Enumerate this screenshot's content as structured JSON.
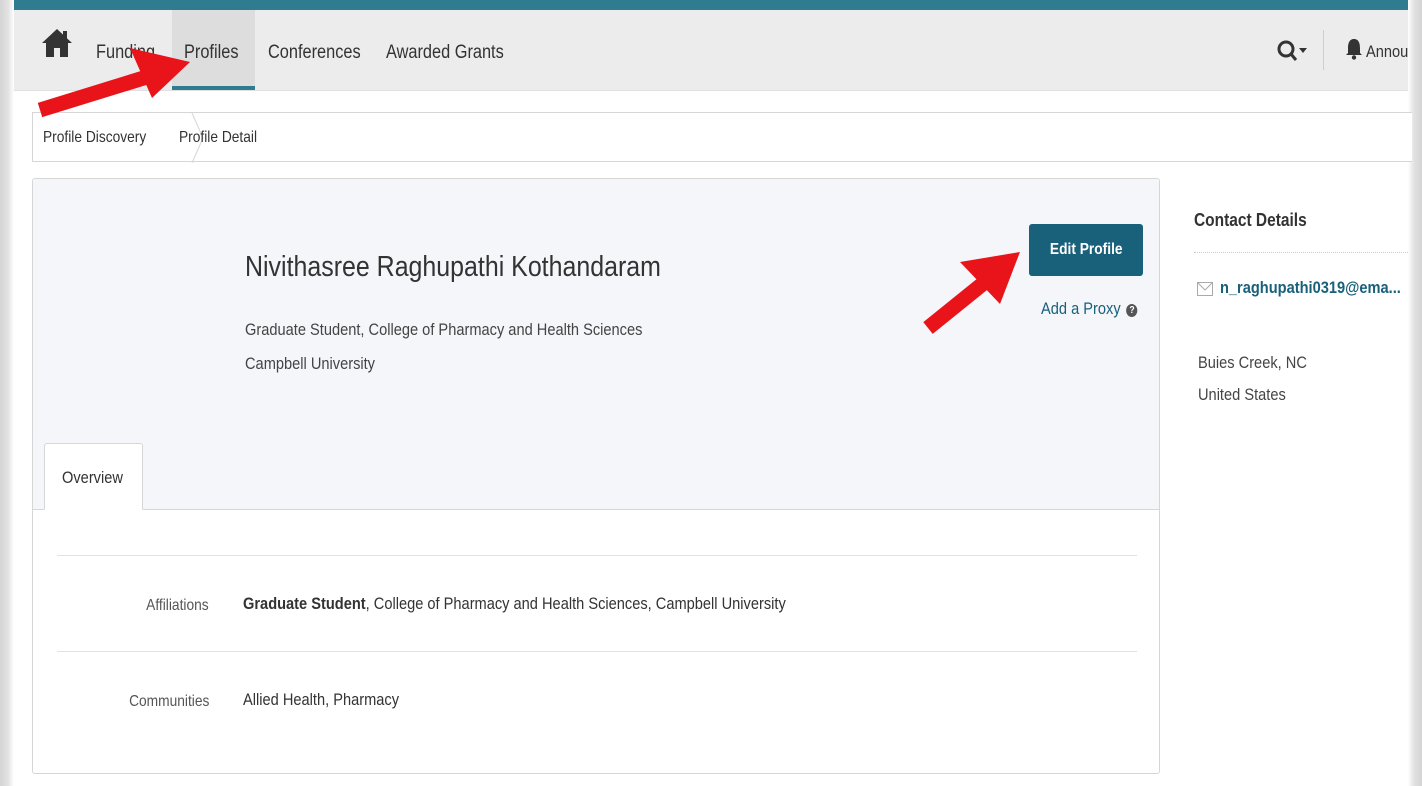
{
  "nav": {
    "items": [
      "Funding",
      "Profiles",
      "Conferences",
      "Awarded Grants"
    ],
    "active_item": "Profiles",
    "announcements_label": "Annou"
  },
  "breadcrumb": [
    "Profile Discovery",
    "Profile Detail"
  ],
  "profile": {
    "name": "Nivithasree Raghupathi Kothandaram",
    "title": "Graduate Student, College of Pharmacy and Health Sciences",
    "institution": "Campbell University",
    "edit_button": "Edit Profile",
    "proxy_link": "Add a Proxy",
    "tab": "Overview",
    "affiliations_label": "Affiliations",
    "affiliations_role": "Graduate Student",
    "affiliations_rest": ", College of Pharmacy and Health Sciences, Campbell University",
    "communities_label": "Communities",
    "communities_value": "Allied Health, Pharmacy"
  },
  "contact": {
    "title": "Contact Details",
    "email": "n_raghupathi0319@ema...",
    "city": "Buies Creek, NC",
    "country": "United States"
  },
  "icons": [
    "home-icon",
    "search-icon",
    "bell-icon",
    "help-icon",
    "mail-icon",
    "red-arrow-annotation"
  ],
  "colors": {
    "accent": "#2f7c91",
    "button": "#19607a",
    "annotation": "#e8141a"
  }
}
